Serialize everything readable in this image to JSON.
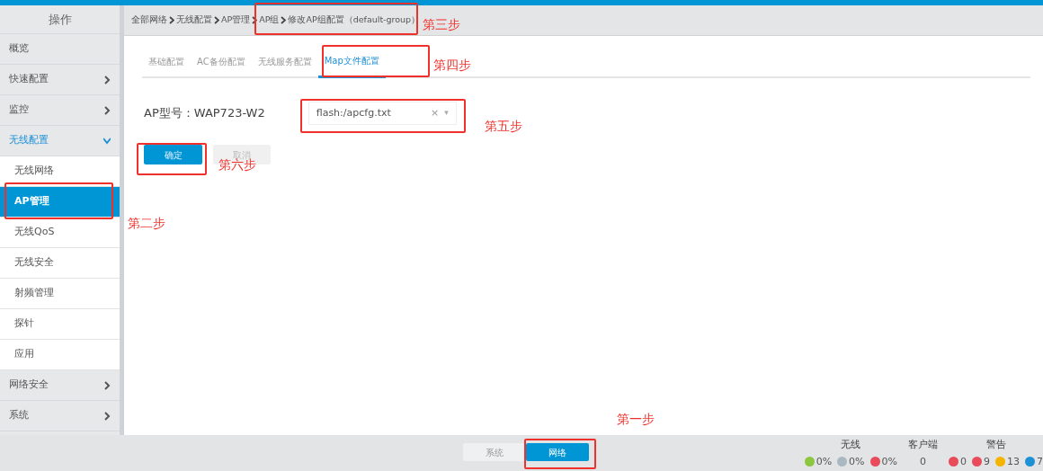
{
  "sidebar": {
    "header": "操作",
    "items": [
      {
        "label": "概览",
        "kind": "plain"
      },
      {
        "label": "快速配置",
        "kind": "group",
        "expanded": false
      },
      {
        "label": "监控",
        "kind": "group",
        "expanded": false
      },
      {
        "label": "无线配置",
        "kind": "group",
        "expanded": true,
        "children": [
          {
            "label": "无线网络",
            "selected": false
          },
          {
            "label": "AP管理",
            "selected": true
          },
          {
            "label": "无线QoS",
            "selected": false
          },
          {
            "label": "无线安全",
            "selected": false
          },
          {
            "label": "射频管理",
            "selected": false
          },
          {
            "label": "探针",
            "selected": false
          },
          {
            "label": "应用",
            "selected": false
          }
        ]
      },
      {
        "label": "网络安全",
        "kind": "group",
        "expanded": false
      },
      {
        "label": "系统",
        "kind": "group",
        "expanded": false
      }
    ]
  },
  "breadcrumb": [
    "全部网络",
    "无线配置",
    "AP管理",
    "AP组",
    "修改AP组配置（default-group）"
  ],
  "tabs": [
    {
      "label": "基础配置",
      "selected": false
    },
    {
      "label": "AC备份配置",
      "selected": false
    },
    {
      "label": "无线服务配置",
      "selected": false
    },
    {
      "label": "Map文件配置",
      "selected": true
    }
  ],
  "form": {
    "label": "AP型号：WAP723-W2",
    "select_value": "flash:/apcfg.txt",
    "clear": "×",
    "caret": "▾"
  },
  "buttons": [
    {
      "label": "确定",
      "kind": "primary"
    },
    {
      "label": "取消",
      "kind": "secondary"
    }
  ],
  "bottom_tabs": [
    {
      "label": "系统",
      "selected": false
    },
    {
      "label": "网络",
      "selected": true
    }
  ],
  "status": [
    {
      "title": "无线",
      "stats": [
        {
          "value": "0%",
          "color": "#8dc63f"
        },
        {
          "value": "0%",
          "color": "#aab8c2"
        },
        {
          "value": "0%",
          "color": "#e94b5b"
        }
      ]
    },
    {
      "title": "客户端",
      "stats": [
        {
          "value": "0"
        }
      ]
    },
    {
      "title": "警告",
      "stats": [
        {
          "value": "0",
          "color": "#e94b5b"
        },
        {
          "value": "9",
          "color": "#e94b5b"
        },
        {
          "value": "13",
          "color": "#f5b400"
        },
        {
          "value": "7",
          "color": "#1e90d6"
        }
      ]
    }
  ],
  "annotations": [
    {
      "text": "第一步"
    },
    {
      "text": "第二步"
    },
    {
      "text": "第三步"
    },
    {
      "text": "第四步"
    },
    {
      "text": "第五步"
    },
    {
      "text": "第六步"
    }
  ]
}
